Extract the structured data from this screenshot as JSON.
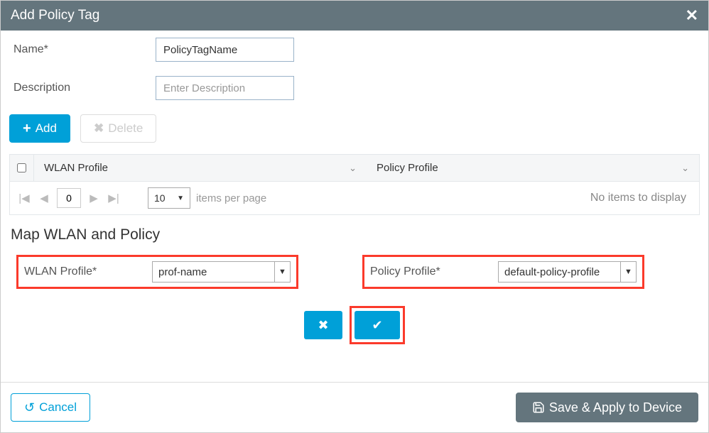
{
  "header": {
    "title": "Add Policy Tag"
  },
  "form": {
    "name_label": "Name*",
    "name_value": "PolicyTagName",
    "desc_label": "Description",
    "desc_placeholder": "Enter Description"
  },
  "buttons": {
    "add": "Add",
    "delete": "Delete",
    "cancel": "Cancel",
    "save": "Save & Apply to Device"
  },
  "table": {
    "col1": "WLAN Profile",
    "col2": "Policy Profile",
    "page_num": "0",
    "ipp_value": "10",
    "ipp_label": "items per page",
    "empty": "No items to display"
  },
  "map": {
    "section_title": "Map WLAN and Policy",
    "wlan_label": "WLAN Profile*",
    "wlan_value": "prof-name",
    "policy_label": "Policy Profile*",
    "policy_value": "default-policy-profile"
  }
}
